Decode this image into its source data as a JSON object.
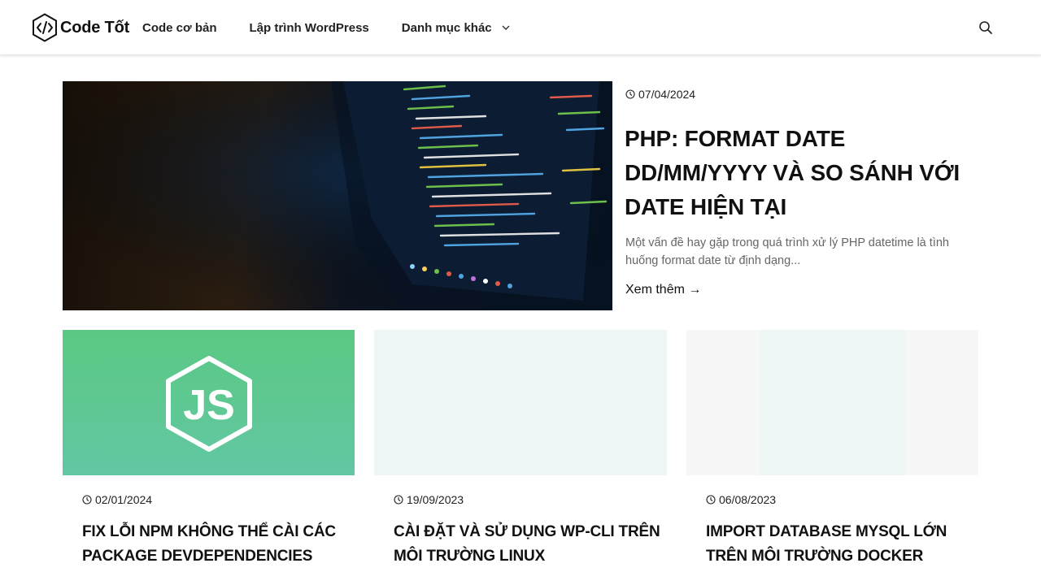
{
  "site": {
    "name": "Code Tốt"
  },
  "nav": {
    "items": [
      "Code cơ bản",
      "Lập trình WordPress",
      "Danh mục khác"
    ]
  },
  "featured": {
    "date": "07/04/2024",
    "title": "PHP: Format date dd/mm/yyyy và so sánh với date hiện tại",
    "excerpt": "Một vấn đề hay gặp trong quá trình xử lý PHP datetime là tình huống format date từ định dạng...",
    "read_more": "Xem thêm"
  },
  "posts": [
    {
      "date": "02/01/2024",
      "title": "Fix lỗi NPM không thể cài các package devDependencies",
      "thumb_color": "#5cc98a"
    },
    {
      "date": "19/09/2023",
      "title": "Cài đặt và sử dụng WP-CLI trên môi trường Linux",
      "thumb_color": "#eef6f6"
    },
    {
      "date": "06/08/2023",
      "title": "Import database MySQL lớn trên môi trường Docker",
      "thumb_color": "#eef6f5"
    }
  ],
  "colors": {
    "text": "#111111",
    "muted": "#666666",
    "header_bg": "#ffffff"
  },
  "icons": {
    "logo": "code-brackets-hexagon-icon",
    "search": "search-icon",
    "date": "clock-icon",
    "dropdown": "chevron-down-icon",
    "read_more": "arrow-right-icon"
  }
}
